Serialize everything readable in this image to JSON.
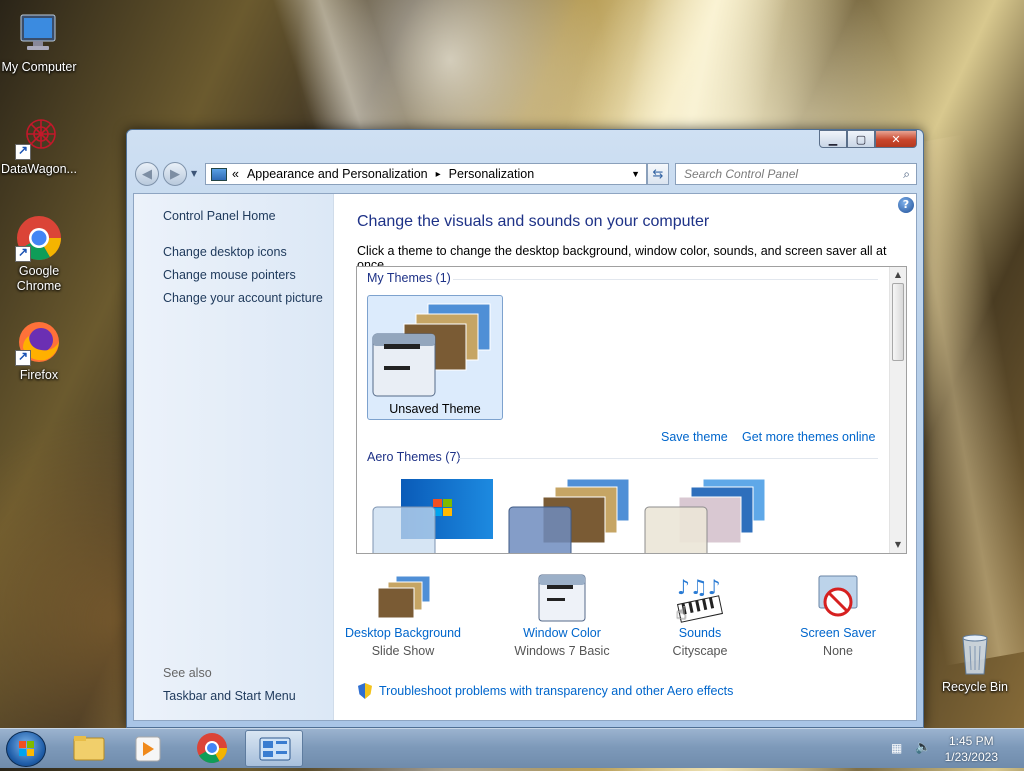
{
  "desktop": {
    "icons": [
      {
        "label": "My Computer",
        "icon": "computer-icon"
      },
      {
        "label": "DataWagon...",
        "icon": "datawagon-icon"
      },
      {
        "label": "Google Chrome",
        "icon": "chrome-icon"
      },
      {
        "label": "Firefox",
        "icon": "firefox-icon"
      },
      {
        "label": "Recycle Bin",
        "icon": "recycle-bin-icon"
      }
    ]
  },
  "window": {
    "controls": {
      "minimize": "minimize-icon",
      "maximize": "maximize-icon",
      "close": "close-icon"
    },
    "address": {
      "overflow": "«",
      "crumbs": [
        "Appearance and Personalization",
        "Personalization"
      ],
      "separator": "▸"
    },
    "search": {
      "placeholder": "Search Control Panel"
    },
    "left_pane": {
      "home": "Control Panel Home",
      "links": [
        "Change desktop icons",
        "Change mouse pointers",
        "Change your account picture"
      ],
      "see_also": "See also",
      "see_also_links": [
        "Taskbar and Start Menu"
      ]
    },
    "main": {
      "title": "Change the visuals and sounds on your computer",
      "description": "Click a theme to change the desktop background, window color, sounds, and screen saver all at once.",
      "my_themes": {
        "heading": "My Themes (1)",
        "themes": [
          {
            "name": "Unsaved Theme",
            "selected": true
          }
        ]
      },
      "save_theme": "Save theme",
      "get_more": "Get more themes online",
      "aero_themes": {
        "heading": "Aero Themes (7)"
      },
      "bottom": [
        {
          "label": "Desktop Background",
          "sub": "Slide Show",
          "icon": "desktop-background-icon"
        },
        {
          "label": "Window Color",
          "sub": "Windows 7 Basic",
          "icon": "window-color-icon"
        },
        {
          "label": "Sounds",
          "sub": "Cityscape",
          "icon": "sounds-icon"
        },
        {
          "label": "Screen Saver",
          "sub": "None",
          "icon": "screen-saver-icon"
        }
      ],
      "troubleshoot": "Troubleshoot problems with transparency and other Aero effects"
    }
  },
  "taskbar": {
    "pinned": [
      "windows-explorer-icon",
      "media-player-icon",
      "chrome-icon",
      "control-panel-icon"
    ],
    "time": "1:45 PM",
    "date": "1/23/2023"
  }
}
